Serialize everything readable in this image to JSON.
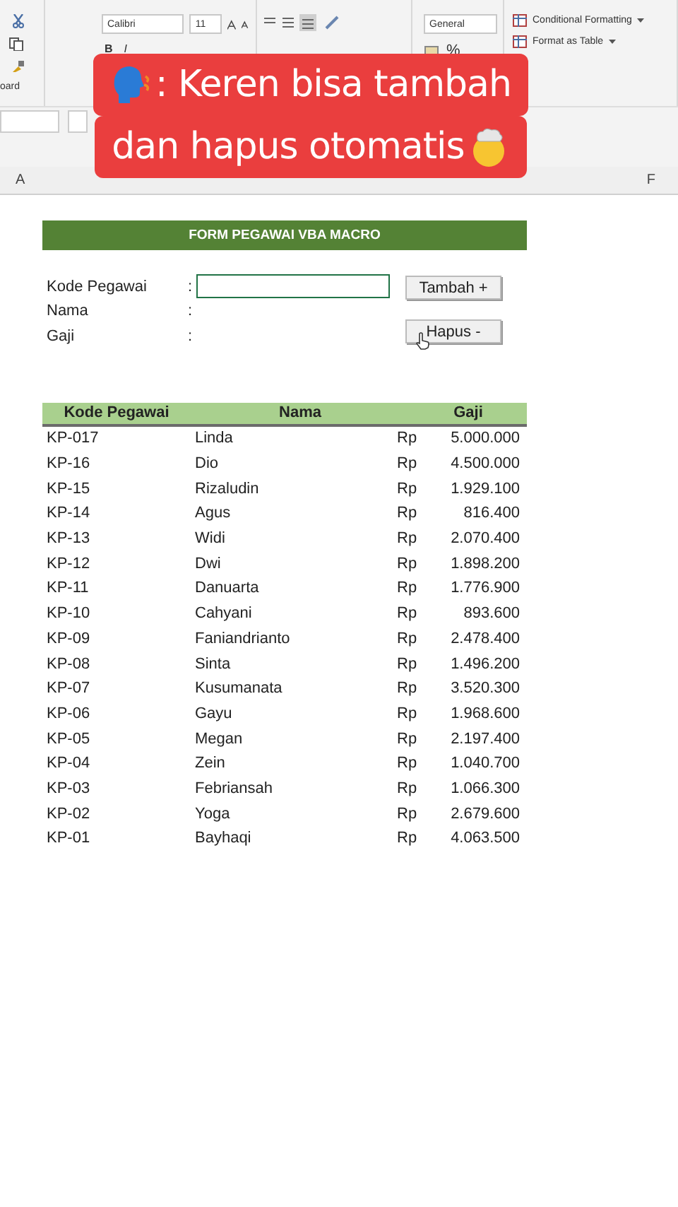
{
  "ribbon": {
    "clipboard_label": "oard",
    "font_name": "Calibri",
    "font_size": "11",
    "bold": "B",
    "italic": "I",
    "number_format": "General",
    "percent": "%",
    "styles": [
      "Conditional Formatting",
      "Format as Table"
    ]
  },
  "columns": [
    "A",
    "F"
  ],
  "caption": {
    "lines": [
      ": Keren bisa tambah",
      "dan hapus otomatis"
    ]
  },
  "form": {
    "title": "FORM PEGAWAI VBA MACRO",
    "fields": [
      {
        "label": "Kode Pegawai",
        "separator": ":",
        "kind": "input"
      },
      {
        "label": "Nama",
        "separator": ":",
        "kind": "text"
      },
      {
        "label": "Gaji",
        "separator": ":",
        "kind": "text"
      }
    ],
    "buttons": [
      "Tambah +",
      "Hapus -"
    ]
  },
  "table": {
    "columns": [
      "Kode Pegawai",
      "Nama",
      "Gaji"
    ],
    "rows": [
      {
        "kode": "KP-017",
        "nama": "Linda",
        "currency": "Rp",
        "gaji": "5.000.000"
      },
      {
        "kode": "KP-16",
        "nama": "Dio",
        "currency": "Rp",
        "gaji": "4.500.000"
      },
      {
        "kode": "KP-15",
        "nama": "Rizaludin",
        "currency": "Rp",
        "gaji": "1.929.100"
      },
      {
        "kode": "KP-14",
        "nama": "Agus",
        "currency": "Rp",
        "gaji": "816.400"
      },
      {
        "kode": "KP-13",
        "nama": "Widi",
        "currency": "Rp",
        "gaji": "2.070.400"
      },
      {
        "kode": "KP-12",
        "nama": "Dwi",
        "currency": "Rp",
        "gaji": "1.898.200"
      },
      {
        "kode": "KP-11",
        "nama": "Danuarta",
        "currency": "Rp",
        "gaji": "1.776.900"
      },
      {
        "kode": "KP-10",
        "nama": "Cahyani",
        "currency": "Rp",
        "gaji": "893.600"
      },
      {
        "kode": "KP-09",
        "nama": "Faniandrianto",
        "currency": "Rp",
        "gaji": "2.478.400"
      },
      {
        "kode": "KP-08",
        "nama": "Sinta",
        "currency": "Rp",
        "gaji": "1.496.200"
      },
      {
        "kode": "KP-07",
        "nama": "Kusumanata",
        "currency": "Rp",
        "gaji": "3.520.300"
      },
      {
        "kode": "KP-06",
        "nama": "Gayu",
        "currency": "Rp",
        "gaji": "1.968.600"
      },
      {
        "kode": "KP-05",
        "nama": "Megan",
        "currency": "Rp",
        "gaji": "2.197.400"
      },
      {
        "kode": "KP-04",
        "nama": "Zein",
        "currency": "Rp",
        "gaji": "1.040.700"
      },
      {
        "kode": "KP-03",
        "nama": "Febriansah",
        "currency": "Rp",
        "gaji": "1.066.300"
      },
      {
        "kode": "KP-02",
        "nama": "Yoga",
        "currency": "Rp",
        "gaji": "2.679.600"
      },
      {
        "kode": "KP-01",
        "nama": "Bayhaqi",
        "currency": "Rp",
        "gaji": "4.063.500"
      }
    ]
  }
}
